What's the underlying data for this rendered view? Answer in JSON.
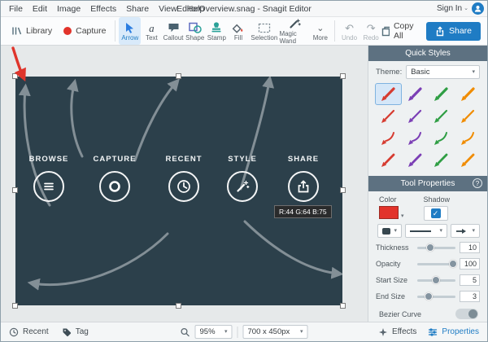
{
  "colors": {
    "accent": "#1f7cc4",
    "canvas_bg": "#2c404b",
    "panel_header_bg": "#5d7181",
    "annotation_red": "#df352c"
  },
  "icons": {
    "dropdown_arrow": "▾",
    "chevron_down": "⌄",
    "undo": "↶",
    "redo": "↷",
    "check": "✓"
  },
  "menubar": {
    "items": [
      "File",
      "Edit",
      "Image",
      "Effects",
      "Share",
      "View",
      "Help"
    ],
    "title": "EditorOverview.snag - Snagit Editor",
    "sign_in": "Sign In"
  },
  "toolbar": {
    "library_label": "Library",
    "capture_label": "Capture",
    "tools": [
      {
        "label": "Arrow",
        "selected": true
      },
      {
        "label": "Text"
      },
      {
        "label": "Callout"
      },
      {
        "label": "Shape"
      },
      {
        "label": "Stamp"
      },
      {
        "label": "Fill"
      },
      {
        "label": "Selection"
      },
      {
        "label": "Magic Wand"
      },
      {
        "label": "More"
      }
    ],
    "undo_label": "Undo",
    "redo_label": "Redo",
    "copy_all_label": "Copy All",
    "share_label": "Share"
  },
  "quick_styles": {
    "title": "Quick Styles",
    "theme_label": "Theme:",
    "theme_value": "Basic",
    "style_colors": [
      "#d63c31",
      "#7b3fb5",
      "#2f9e44",
      "#f08c00"
    ]
  },
  "tool_properties": {
    "title": "Tool Properties",
    "help_label": "?",
    "color_label": "Color",
    "shadow_label": "Shadow",
    "sliders": [
      {
        "label": "Thickness",
        "value": "10"
      },
      {
        "label": "Opacity",
        "value": "100"
      },
      {
        "label": "Start Size",
        "value": "5"
      },
      {
        "label": "End Size",
        "value": "3"
      }
    ],
    "bezier_label": "Bezier Curve"
  },
  "canvas": {
    "labels": [
      "BROWSE",
      "CAPTURE",
      "RECENT",
      "STYLE",
      "SHARE"
    ],
    "tooltip": "R:44 G:64 B:75"
  },
  "statusbar": {
    "recent_label": "Recent",
    "tag_label": "Tag",
    "zoom_value": "95%",
    "size_value": "700 x 450px",
    "effects_label": "Effects",
    "properties_label": "Properties"
  }
}
